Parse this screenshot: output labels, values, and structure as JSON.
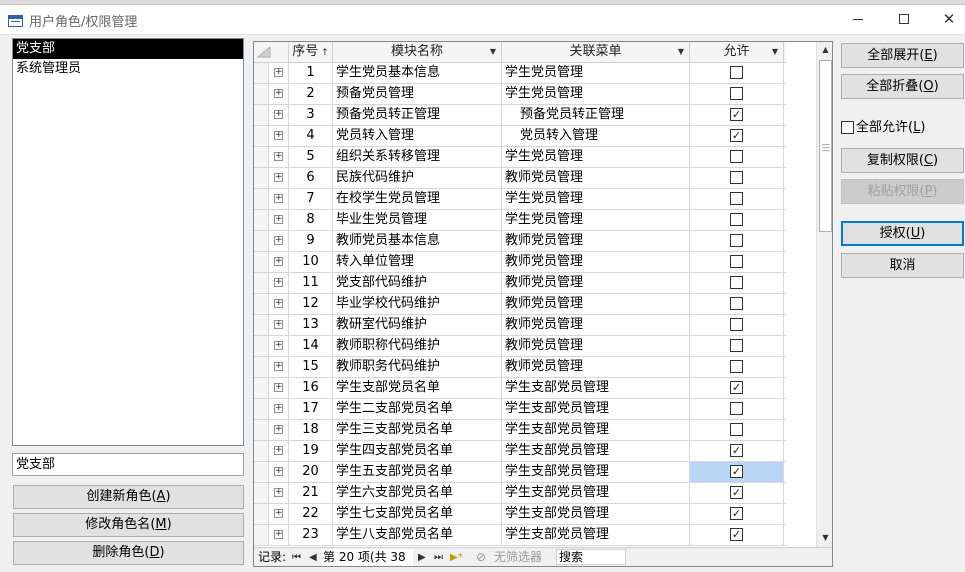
{
  "window": {
    "title": "用户角色/权限管理"
  },
  "roles": {
    "items": [
      {
        "label": "党支部",
        "selected": true
      },
      {
        "label": "系统管理员",
        "selected": false
      }
    ],
    "current_name": "党支部"
  },
  "left_buttons": [
    {
      "label": "创建新角色",
      "key": "A"
    },
    {
      "label": "修改角色名",
      "key": "M"
    },
    {
      "label": "删除角色",
      "key": "D"
    }
  ],
  "grid": {
    "columns": {
      "num": "序号",
      "module": "模块名称",
      "menu": "关联菜单",
      "allow": "允许"
    },
    "current_row": 20,
    "rows": [
      {
        "num": "1",
        "module": "学生党员基本信息",
        "menu": "学生党员管理",
        "allow": false,
        "indent": false
      },
      {
        "num": "2",
        "module": "预备党员管理",
        "menu": "学生党员管理",
        "allow": false,
        "indent": false
      },
      {
        "num": "3",
        "module": "预备党员转正管理",
        "menu": "预备党员转正管理",
        "allow": true,
        "indent": true
      },
      {
        "num": "4",
        "module": "党员转入管理",
        "menu": "党员转入管理",
        "allow": true,
        "indent": true
      },
      {
        "num": "5",
        "module": "组织关系转移管理",
        "menu": "学生党员管理",
        "allow": false,
        "indent": false
      },
      {
        "num": "6",
        "module": "民族代码维护",
        "menu": "教师党员管理",
        "allow": false,
        "indent": false
      },
      {
        "num": "7",
        "module": "在校学生党员管理",
        "menu": "学生党员管理",
        "allow": false,
        "indent": false
      },
      {
        "num": "8",
        "module": "毕业生党员管理",
        "menu": "学生党员管理",
        "allow": false,
        "indent": false
      },
      {
        "num": "9",
        "module": "教师党员基本信息",
        "menu": "教师党员管理",
        "allow": false,
        "indent": false
      },
      {
        "num": "10",
        "module": "转入单位管理",
        "menu": "教师党员管理",
        "allow": false,
        "indent": false
      },
      {
        "num": "11",
        "module": "党支部代码维护",
        "menu": "教师党员管理",
        "allow": false,
        "indent": false
      },
      {
        "num": "12",
        "module": "毕业学校代码维护",
        "menu": "教师党员管理",
        "allow": false,
        "indent": false
      },
      {
        "num": "13",
        "module": "教研室代码维护",
        "menu": "教师党员管理",
        "allow": false,
        "indent": false
      },
      {
        "num": "14",
        "module": "教师职称代码维护",
        "menu": "教师党员管理",
        "allow": false,
        "indent": false
      },
      {
        "num": "15",
        "module": "教师职务代码维护",
        "menu": "教师党员管理",
        "allow": false,
        "indent": false
      },
      {
        "num": "16",
        "module": "学生支部党员名单",
        "menu": "学生支部党员管理",
        "allow": true,
        "indent": false
      },
      {
        "num": "17",
        "module": "学生二支部党员名单",
        "menu": "学生支部党员管理",
        "allow": false,
        "indent": false
      },
      {
        "num": "18",
        "module": "学生三支部党员名单",
        "menu": "学生支部党员管理",
        "allow": false,
        "indent": false
      },
      {
        "num": "19",
        "module": "学生四支部党员名单",
        "menu": "学生支部党员管理",
        "allow": true,
        "indent": false
      },
      {
        "num": "20",
        "module": "学生五支部党员名单",
        "menu": "学生支部党员管理",
        "allow": true,
        "indent": false
      },
      {
        "num": "21",
        "module": "学生六支部党员名单",
        "menu": "学生支部党员管理",
        "allow": true,
        "indent": false
      },
      {
        "num": "22",
        "module": "学生七支部党员名单",
        "menu": "学生支部党员管理",
        "allow": true,
        "indent": false
      },
      {
        "num": "23",
        "module": "学生八支部党员名单",
        "menu": "学生支部党员管理",
        "allow": true,
        "indent": false
      }
    ]
  },
  "navigator": {
    "record_label": "记录:",
    "page_text": "第 20 项(共 38 I",
    "no_filter": "无筛选器",
    "search": "搜索"
  },
  "right_buttons": {
    "expand_all": {
      "label": "全部展开",
      "key": "E"
    },
    "collapse_all": {
      "label": "全部折叠",
      "key": "O"
    },
    "allow_all": {
      "label": "全部允许",
      "key": "L",
      "checked": false
    },
    "copy_perm": {
      "label": "复制权限",
      "key": "C"
    },
    "paste_perm": {
      "label": "粘贴权限",
      "key": "P",
      "disabled": true
    },
    "grant": {
      "label": "授权",
      "key": "U"
    },
    "cancel": {
      "label": "取消"
    }
  }
}
